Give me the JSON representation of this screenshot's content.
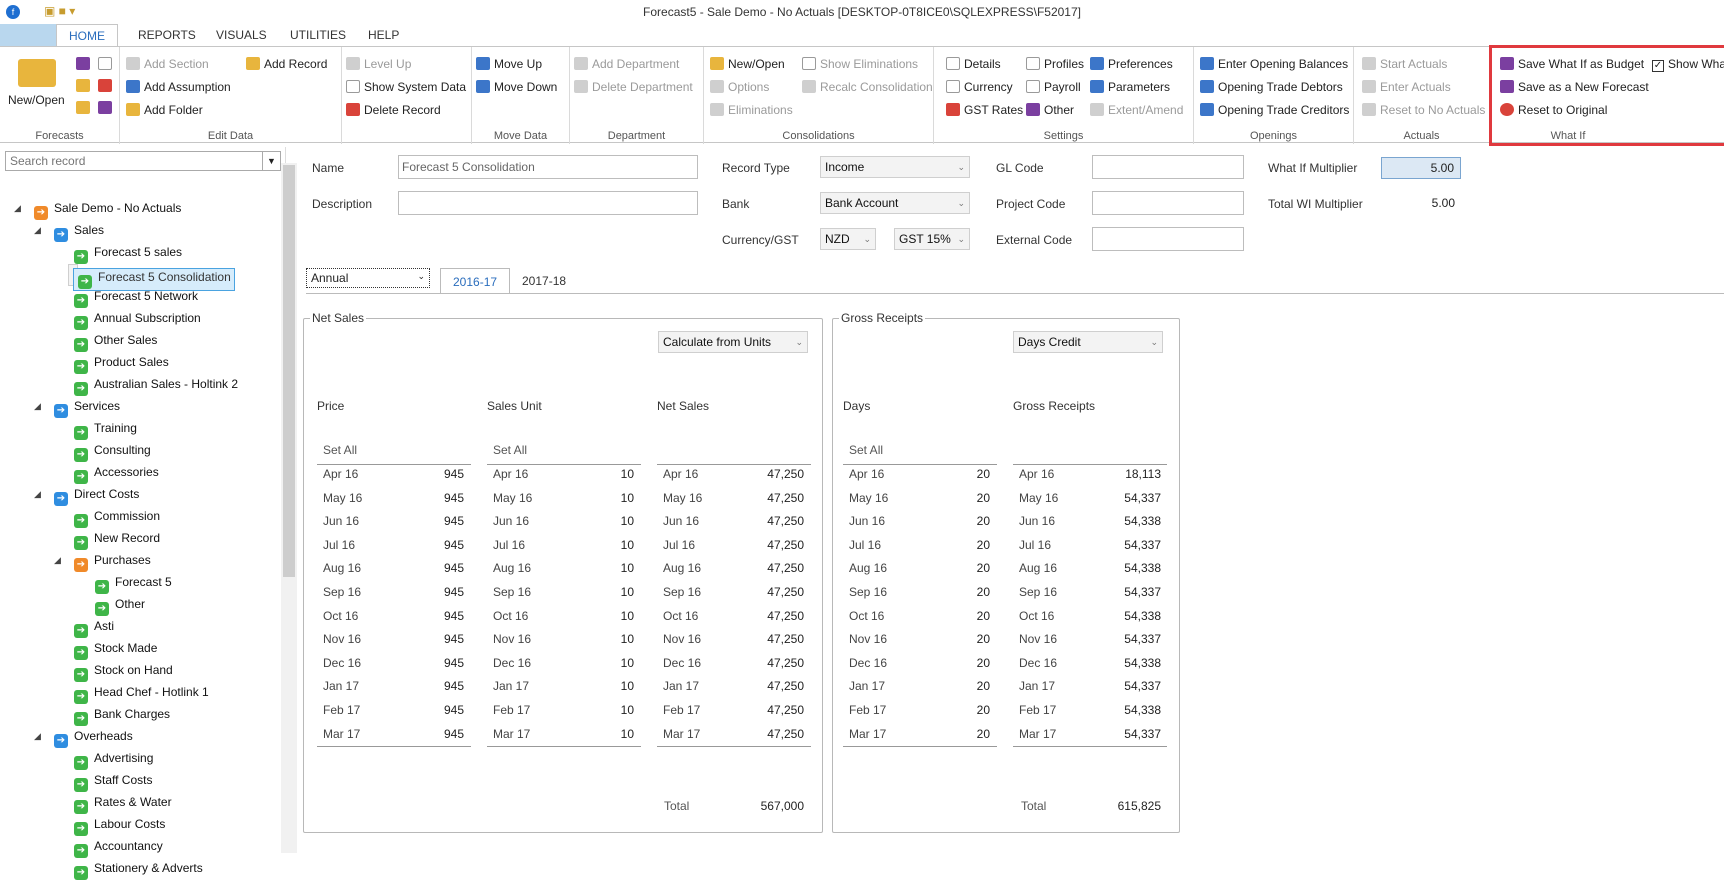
{
  "window": {
    "title": "Forecast5 - Sale Demo - No Actuals [DESKTOP-0T8ICE0\\SQLEXPRESS\\F52017]"
  },
  "tabs": {
    "home": "HOME",
    "reports": "REPORTS",
    "visuals": "VISUALS",
    "utilities": "UTILITIES",
    "help": "HELP"
  },
  "ribbon": {
    "forecasts": {
      "new_open": "New/Open",
      "label": "Forecasts"
    },
    "edit": {
      "add_section": "Add Section",
      "add_assumption": "Add Assumption",
      "add_folder": "Add Folder",
      "add_record": "Add Record",
      "level_up": "Level Up",
      "show_system_data": "Show System Data",
      "delete_record": "Delete Record",
      "label": "Edit Data"
    },
    "move": {
      "move_up": "Move Up",
      "move_down": "Move Down",
      "label": "Move Data"
    },
    "department": {
      "add": "Add Department",
      "delete": "Delete Department",
      "label": "Department"
    },
    "consol": {
      "new_open": "New/Open",
      "options": "Options",
      "eliminations": "Eliminations",
      "show_elim": "Show Eliminations",
      "recalc": "Recalc Consolidation",
      "label": "Consolidations"
    },
    "settings": {
      "details": "Details",
      "currency": "Currency",
      "gst_rates": "GST Rates",
      "profiles": "Profiles",
      "payroll": "Payroll",
      "other": "Other",
      "preferences": "Preferences",
      "parameters": "Parameters",
      "extent_amend": "Extent/Amend",
      "label": "Settings"
    },
    "openings": {
      "enter_balances": "Enter Opening Balances",
      "trade_debtors": "Opening Trade Debtors",
      "trade_creditors": "Opening Trade Creditors",
      "label": "Openings"
    },
    "actuals": {
      "start": "Start Actuals",
      "enter": "Enter Actuals",
      "reset": "Reset to No Actuals",
      "label": "Actuals"
    },
    "whatif": {
      "save_budget": "Save What If as Budget",
      "show": "Show Wha",
      "save_new": "Save as a New Forecast",
      "reset": "Reset to Original",
      "label": "What If"
    }
  },
  "sidebar": {
    "search_placeholder": "Search record",
    "tree": {
      "root": "Sale Demo - No Actuals",
      "sales": "Sales",
      "f5sales": "Forecast 5 sales",
      "f5consol": "Forecast 5 Consolidation",
      "f5network": "Forecast 5 Network",
      "annual_sub": "Annual Subscription",
      "other_sales": "Other Sales",
      "product_sales": "Product Sales",
      "aus_sales": "Australian Sales - Holtink 2",
      "services": "Services",
      "training": "Training",
      "consulting": "Consulting",
      "accessories": "Accessories",
      "direct_costs": "Direct Costs",
      "commission": "Commission",
      "new_record": "New Record",
      "purchases": "Purchases",
      "forecast5": "Forecast 5",
      "other": "Other",
      "asti": "Asti",
      "stock_made": "Stock Made",
      "stock_on_hand": "Stock on Hand",
      "head_chef": "Head Chef - Hotlink 1",
      "bank_charges": "Bank Charges",
      "overheads": "Overheads",
      "advertising": "Advertising",
      "staff_costs": "Staff Costs",
      "rates_water": "Rates & Water",
      "labour_costs": "Labour Costs",
      "accountancy": "Accountancy",
      "stationery": "Stationery & Adverts"
    }
  },
  "form": {
    "name_label": "Name",
    "name_value": "Forecast 5 Consolidation",
    "description_label": "Description",
    "description_value": "",
    "record_type_label": "Record Type",
    "record_type_value": "Income",
    "bank_label": "Bank",
    "bank_value": "Bank Account",
    "currency_label": "Currency/GST",
    "currency_value": "NZD",
    "gst_value": "GST 15%",
    "gl_code_label": "GL Code",
    "project_code_label": "Project Code",
    "external_code_label": "External Code",
    "whatif_mult_label": "What If Multiplier",
    "whatif_mult_value": "5.00",
    "total_wi_label": "Total WI Multiplier",
    "total_wi_value": "5.00"
  },
  "period": {
    "select": "Annual",
    "tab1": "2016-17",
    "tab2": "2017-18"
  },
  "net_sales": {
    "title": "Net Sales",
    "method": "Calculate from Units",
    "price_hdr": "Price",
    "unit_hdr": "Sales Unit",
    "net_hdr": "Net Sales",
    "set_all": "Set All",
    "months": [
      "Apr 16",
      "May 16",
      "Jun 16",
      "Jul 16",
      "Aug 16",
      "Sep 16",
      "Oct 16",
      "Nov 16",
      "Dec 16",
      "Jan 17",
      "Feb 17",
      "Mar 17"
    ],
    "price": [
      "945",
      "945",
      "945",
      "945",
      "945",
      "945",
      "945",
      "945",
      "945",
      "945",
      "945",
      "945"
    ],
    "units": [
      "10",
      "10",
      "10",
      "10",
      "10",
      "10",
      "10",
      "10",
      "10",
      "10",
      "10",
      "10"
    ],
    "net": [
      "47,250",
      "47,250",
      "47,250",
      "47,250",
      "47,250",
      "47,250",
      "47,250",
      "47,250",
      "47,250",
      "47,250",
      "47,250",
      "47,250"
    ],
    "total_label": "Total",
    "total": "567,000"
  },
  "gross_receipts": {
    "title": "Gross Receipts",
    "method": "Days Credit",
    "days_hdr": "Days",
    "gr_hdr": "Gross Receipts",
    "set_all": "Set All",
    "days": [
      "20",
      "20",
      "20",
      "20",
      "20",
      "20",
      "20",
      "20",
      "20",
      "20",
      "20",
      "20"
    ],
    "gr": [
      "18,113",
      "54,337",
      "54,338",
      "54,337",
      "54,338",
      "54,337",
      "54,338",
      "54,337",
      "54,338",
      "54,337",
      "54,338",
      "54,337"
    ],
    "total_label": "Total",
    "total": "615,825"
  }
}
